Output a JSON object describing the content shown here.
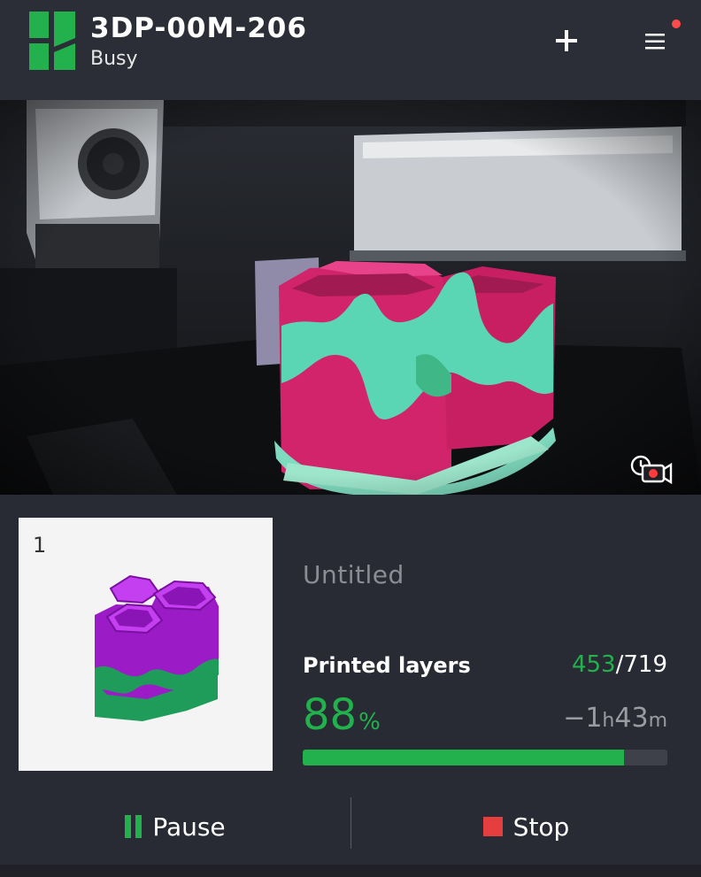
{
  "header": {
    "printer_name": "3DP-00M-206",
    "status": "Busy"
  },
  "icons": {
    "logo": "bambu-logo-icon",
    "add": "plus-icon",
    "menu": "hamburger-menu-icon",
    "camera": "camera-timelapse-icon",
    "pause": "pause-icon",
    "stop": "stop-icon"
  },
  "colors": {
    "accent_green": "#22b14c",
    "stop_red": "#e53e3e",
    "notification_red": "#ff4b4b",
    "background": "#282b33"
  },
  "job": {
    "plate_number": "1",
    "name": "Untitled",
    "layers_label": "Printed layers",
    "layers_current": "453",
    "layers_separator": "/",
    "layers_total": "719",
    "percent_value": "88",
    "percent_unit": "%",
    "remaining_prefix": "−1",
    "remaining_h": "h",
    "remaining_min": "43",
    "remaining_m": "m",
    "progress_fraction": 0.88
  },
  "controls": {
    "pause_label": "Pause",
    "stop_label": "Stop"
  }
}
